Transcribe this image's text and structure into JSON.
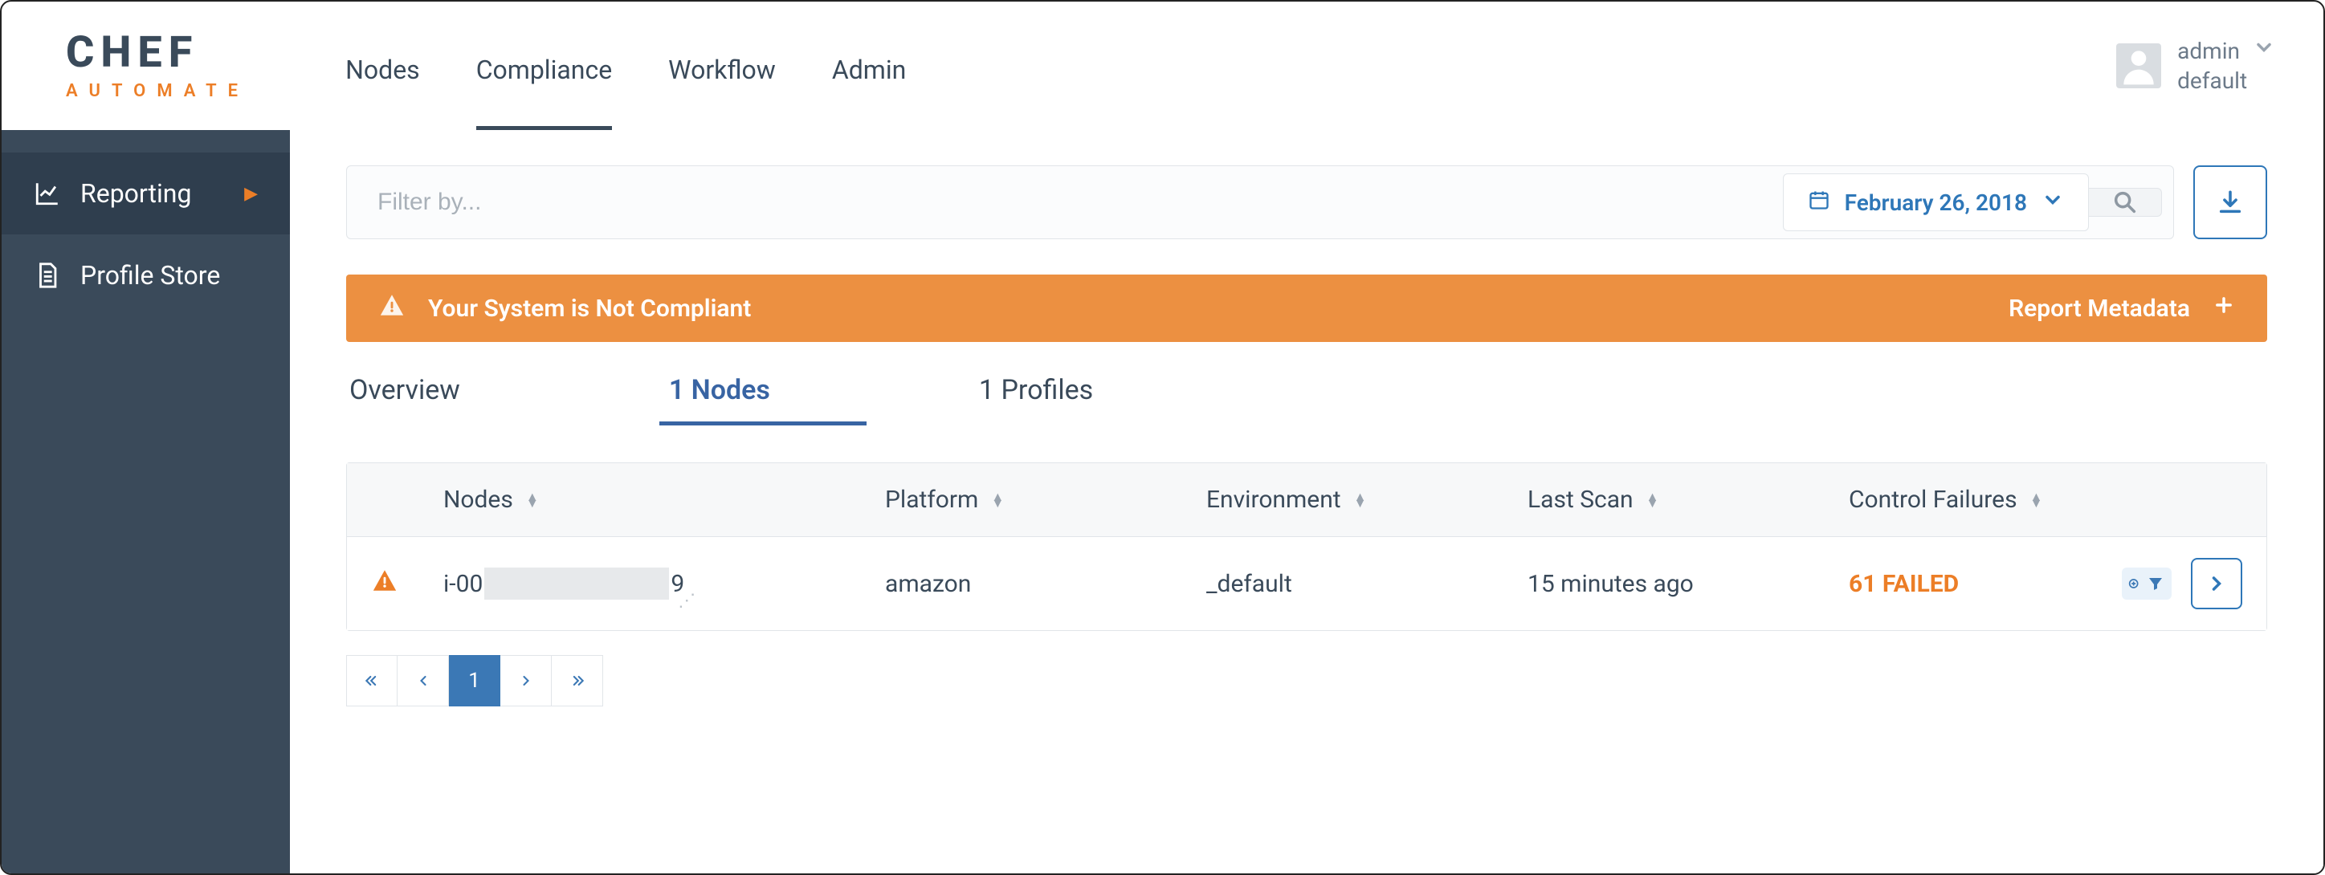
{
  "logo": {
    "main": "CHEF",
    "sub": "AUTOMATE"
  },
  "nav": {
    "items": [
      "Nodes",
      "Compliance",
      "Workflow",
      "Admin"
    ],
    "active": 1
  },
  "profile": {
    "name": "admin",
    "org": "default"
  },
  "sidebar": {
    "items": [
      {
        "label": "Reporting",
        "active": true
      },
      {
        "label": "Profile Store",
        "active": false
      }
    ]
  },
  "filter": {
    "placeholder": "Filter by..."
  },
  "date": {
    "label": "February 26, 2018"
  },
  "banner": {
    "message": "Your System is Not Compliant",
    "action": "Report Metadata"
  },
  "tabs": {
    "items": [
      {
        "label": "Overview",
        "active": false
      },
      {
        "label": "1 Nodes",
        "active": true
      },
      {
        "label": "1 Profiles",
        "active": false
      }
    ]
  },
  "table": {
    "headers": [
      "Nodes",
      "Platform",
      "Environment",
      "Last Scan",
      "Control Failures"
    ],
    "row": {
      "node_prefix": "i-00",
      "node_suffix": "9",
      "platform": "amazon",
      "environment": "_default",
      "last_scan": "15 minutes ago",
      "failures": "61 FAILED"
    }
  },
  "pagination": {
    "current": "1"
  }
}
